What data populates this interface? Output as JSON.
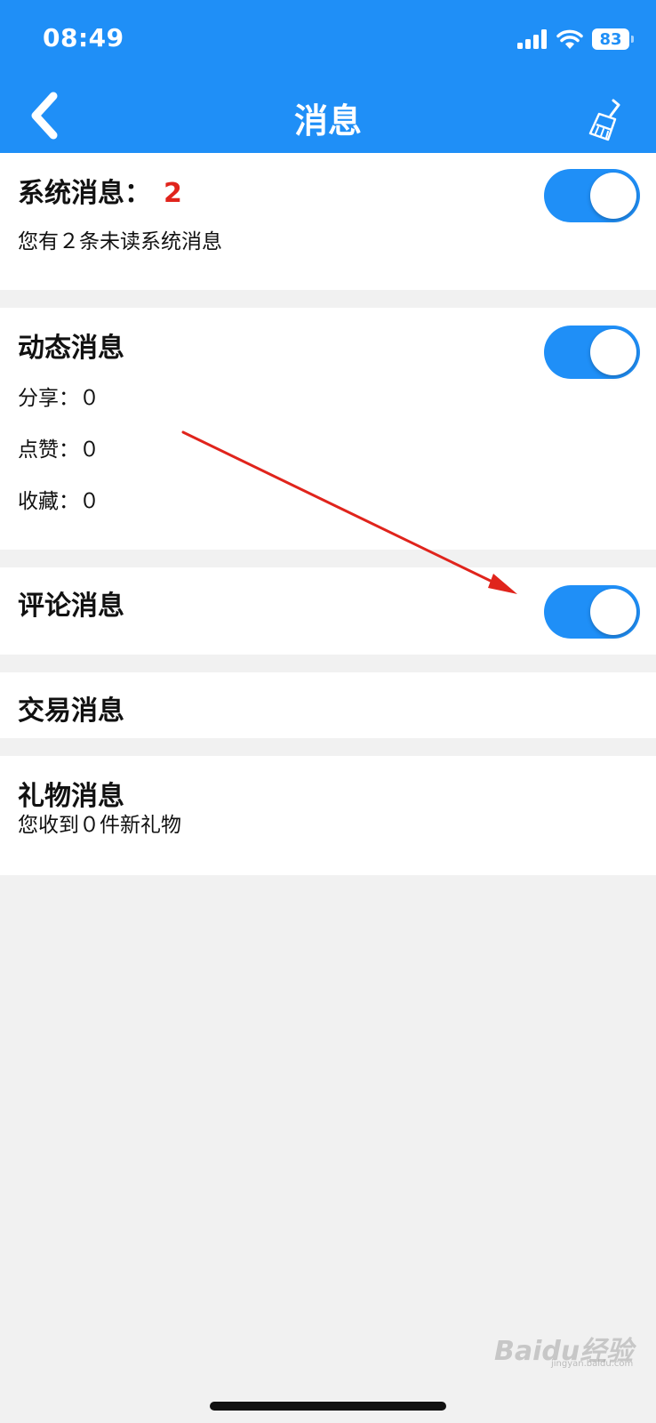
{
  "status_bar": {
    "time": "08:49",
    "battery": "83"
  },
  "header": {
    "title": "消息"
  },
  "system": {
    "title": "系统消息：",
    "count": "2",
    "desc": "您有２条未读系统消息",
    "toggle_on": true
  },
  "activity": {
    "title": "动态消息",
    "share": "分享：０",
    "like": "点赞：０",
    "favorite": "收藏：０",
    "toggle_on": true
  },
  "comment": {
    "title": "评论消息",
    "toggle_on": true
  },
  "trade": {
    "title": "交易消息"
  },
  "gift": {
    "title": "礼物消息",
    "desc": "您收到０件新礼物"
  },
  "watermark": {
    "text": "Baidu经验",
    "sub": "jingyan.baidu.com"
  },
  "colors": {
    "brand": "#1f8ff7",
    "badge": "#e0241c",
    "annotation_arrow": "#e0241c"
  }
}
